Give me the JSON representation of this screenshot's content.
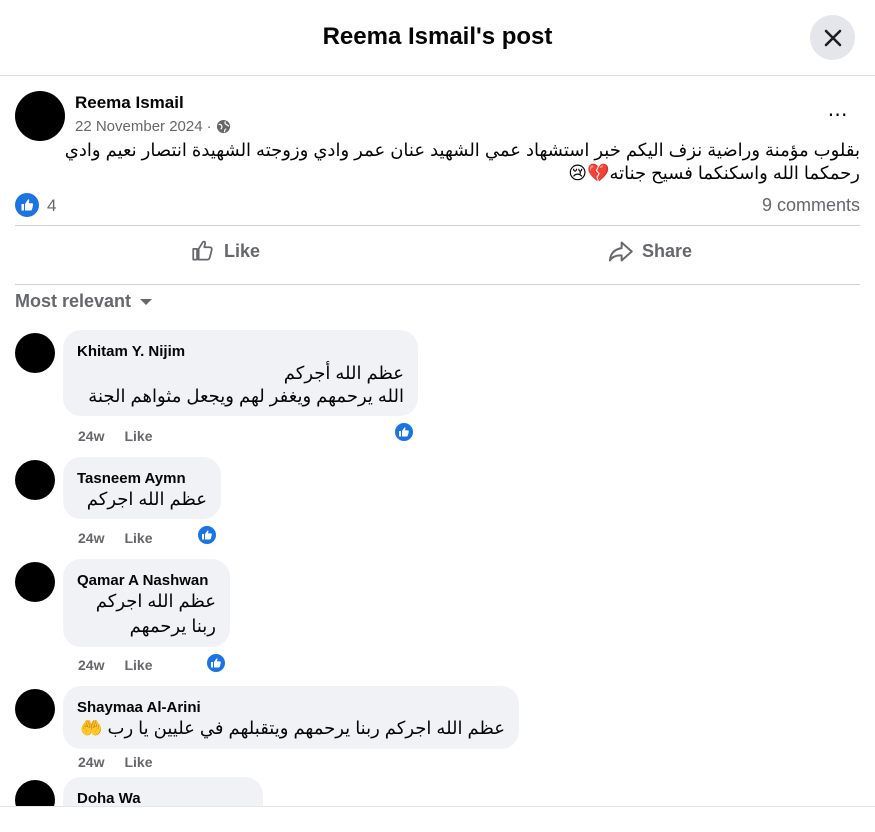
{
  "header": {
    "title": "Reema Ismail's post"
  },
  "post": {
    "author": "Reema Ismail",
    "date": "22 November 2024",
    "separator": "·",
    "text_line1": "بقلوب مؤمنة وراضية نزف اليكم خبر استشهاد عمي الشهيد عنان عمر وادي وزوجته الشهيدة انتصار نعيم وادي",
    "text_line2": "رحمكما الله واسكنكما فسيح جناته💔😢",
    "like_count": "4",
    "comment_count": "9 comments",
    "more_icon": "⋯"
  },
  "actions": {
    "like": "Like",
    "share": "Share"
  },
  "comments_sort": "Most relevant",
  "comments": [
    {
      "name": "Khitam Y. Nijim",
      "line1": "عظم الله أجركم",
      "line2": "الله يرحمهم ويغفر لهم ويجعل مثواهم الجنة",
      "time": "24w",
      "like": "Like",
      "reaction": "like"
    },
    {
      "name": "Tasneem Aymn",
      "line1": "عظم الله اجركم",
      "time": "24w",
      "like": "Like",
      "reaction": "like"
    },
    {
      "name": "Qamar A Nashwan",
      "line1": "عظم الله اجركم",
      "line2": "ربنا يرحمهم",
      "time": "24w",
      "like": "Like",
      "reaction": "like"
    },
    {
      "name": "Shaymaa Al-Arini",
      "line1": "عظم الله اجركم ربنا يرحمهم ويتقبلهم في عليين يا رب 🤲",
      "time": "24w",
      "like": "Like"
    },
    {
      "name": "Doha Wa"
    }
  ],
  "colors": {
    "accent": "#1b74e4",
    "muted": "#65676b",
    "bubble": "#f0f2f5"
  }
}
